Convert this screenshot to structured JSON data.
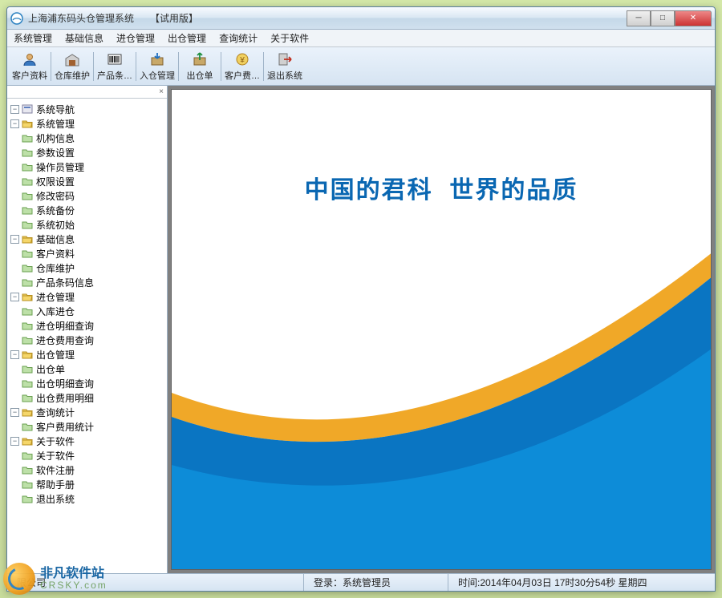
{
  "titlebar": {
    "title": "上海浦东码头仓管理系统",
    "edition": "【试用版】"
  },
  "menubar": [
    "系统管理",
    "基础信息",
    "进仓管理",
    "出仓管理",
    "查询统计",
    "关于软件"
  ],
  "toolbar": [
    {
      "label": "客户资料",
      "icon": "customer"
    },
    {
      "label": "仓库维护",
      "icon": "warehouse"
    },
    {
      "label": "产品条…",
      "icon": "barcode"
    },
    {
      "label": "入仓管理",
      "icon": "inbound"
    },
    {
      "label": "出仓单",
      "icon": "outbound"
    },
    {
      "label": "客户费…",
      "icon": "fee"
    },
    {
      "label": "退出系统",
      "icon": "exit"
    }
  ],
  "sidebar_close": "×",
  "tree": {
    "root": "系统导航",
    "groups": [
      {
        "label": "系统管理",
        "items": [
          "机构信息",
          "参数设置",
          "操作员管理",
          "权限设置",
          "修改密码",
          "系统备份",
          "系统初始"
        ]
      },
      {
        "label": "基础信息",
        "items": [
          "客户资料",
          "仓库维护",
          "产品条码信息"
        ]
      },
      {
        "label": "进仓管理",
        "items": [
          "入库进仓",
          "进仓明细查询",
          "进仓费用查询"
        ]
      },
      {
        "label": "出仓管理",
        "items": [
          "出仓单",
          "出仓明细查询",
          "出仓费用明细"
        ]
      },
      {
        "label": "查询统计",
        "items": [
          "客户费用统计"
        ]
      },
      {
        "label": "关于软件",
        "items": [
          "关于软件",
          "软件注册",
          "帮助手册",
          "退出系统"
        ]
      }
    ]
  },
  "slogan": {
    "part1": "中国的君科",
    "part2": "世界的品质"
  },
  "statusbar": {
    "company_suffix": "限公司",
    "login_label": "登录：",
    "login_user": "系统管理员",
    "time_label": "时间:",
    "time_value": "2014年04月03日  17时30分54秒  星期四"
  },
  "watermark": {
    "main": "非凡软件站",
    "sub": "CRSKY.com"
  },
  "colors": {
    "accent": "#0a67b2",
    "swoosh_orange": "#f0a828",
    "swoosh_blue1": "#0a75c2",
    "swoosh_blue2": "#0d8cd8"
  }
}
